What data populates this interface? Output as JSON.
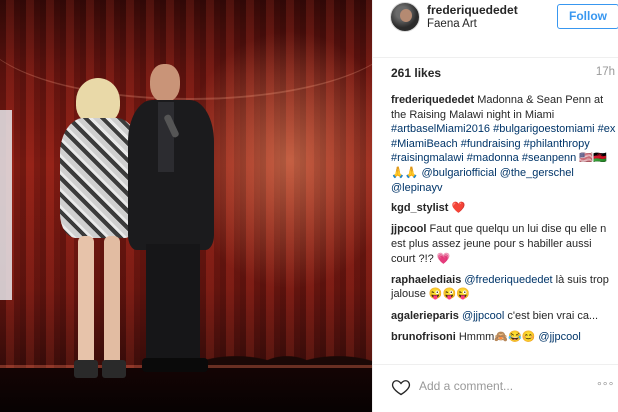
{
  "post": {
    "username": "frederiquededet",
    "location": "Faena Art",
    "follow_label": "Follow",
    "likes": "261 likes",
    "time": "17h",
    "add_comment_placeholder": "Add a comment...",
    "more_label": "°°°"
  },
  "caption": {
    "author": "frederiquededet",
    "text": "Madonna & Sean Penn at the Raising Malawi night in Miami",
    "tags": "#artbaselMiami2016 #bulgarigoestomiami #ex #MiamiBeach #fundraising #philanthropy #raisingmalawi #madonna #seanpenn",
    "emoji": "🇺🇸🇲🇼🙏🙏",
    "mentions": "@bulgariofficial @the_gerschel @lepinayv"
  },
  "comments": [
    {
      "author": "kgd_stylist",
      "text": "❤️"
    },
    {
      "author": "jjpcool",
      "text": "Faut que quelqu un lui dise qu elle n est plus assez jeune pour s habiller aussi court ?!? 💗"
    },
    {
      "author": "raphaelediais",
      "mention": "@frederiquededet",
      "text": " là suis trop jalouse 😜😜😜"
    },
    {
      "author": "agalerieparis",
      "mention": "@jjpcool",
      "text": " c'est bien vrai ca..."
    },
    {
      "author": "brunofrisoni",
      "text": "Hmmm🙈😂😊 ",
      "mention": "@jjpcool"
    }
  ],
  "colors": {
    "accent": "#3897f0",
    "link": "#003569",
    "muted": "#999999"
  },
  "icons": {
    "like": "heart-outline-icon",
    "more": "more-options-icon"
  }
}
